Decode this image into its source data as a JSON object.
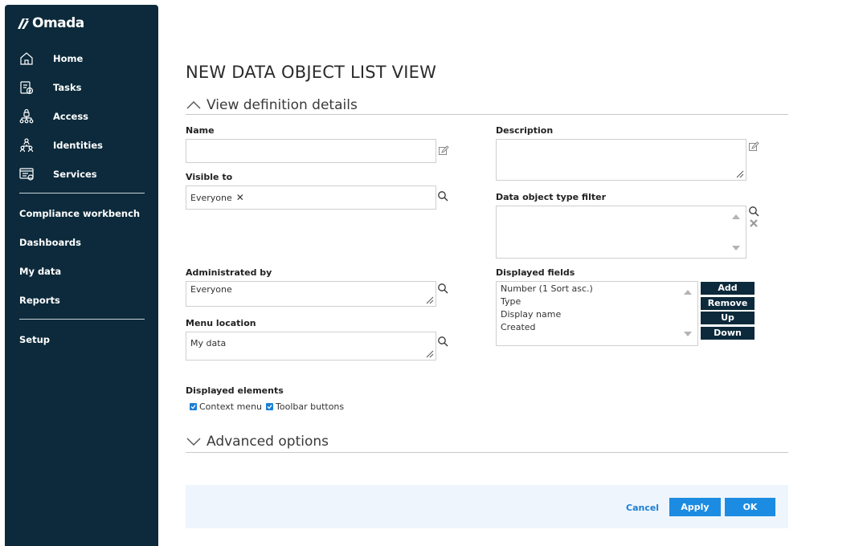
{
  "sidebar": {
    "brand": "Omada",
    "items": [
      {
        "label": "Home",
        "icon": "home-icon"
      },
      {
        "label": "Tasks",
        "icon": "tasks-icon"
      },
      {
        "label": "Access",
        "icon": "access-icon"
      },
      {
        "label": "Identities",
        "icon": "identities-icon"
      },
      {
        "label": "Services",
        "icon": "services-icon"
      }
    ],
    "links": [
      "Compliance workbench",
      "Dashboards",
      "My data",
      "Reports"
    ],
    "setup": "Setup"
  },
  "page": {
    "title": "NEW DATA OBJECT LIST VIEW"
  },
  "sections": {
    "details": "View definition details",
    "advanced": "Advanced options"
  },
  "form": {
    "name_label": "Name",
    "name_value": "",
    "description_label": "Description",
    "description_value": "",
    "visible_to_label": "Visible to",
    "visible_to_chip": "Everyone",
    "type_filter_label": "Data object type filter",
    "administrated_by_label": "Administrated by",
    "administrated_by_value": "Everyone",
    "menu_location_label": "Menu location",
    "menu_location_value": "My data",
    "displayed_fields_label": "Displayed fields",
    "displayed_fields": [
      "Number (1 Sort asc.)",
      "Type",
      "Display name",
      "Created"
    ],
    "field_buttons": {
      "add": "Add",
      "remove": "Remove",
      "up": "Up",
      "down": "Down"
    },
    "displayed_elements_label": "Displayed elements",
    "context_menu_label": "Context menu",
    "toolbar_buttons_label": "Toolbar buttons"
  },
  "footer": {
    "cancel": "Cancel",
    "apply": "Apply",
    "ok": "OK"
  },
  "colors": {
    "sidebar_bg": "#0c2a3b",
    "accent": "#1c8ce3",
    "footer_bg": "#eef5fc"
  }
}
